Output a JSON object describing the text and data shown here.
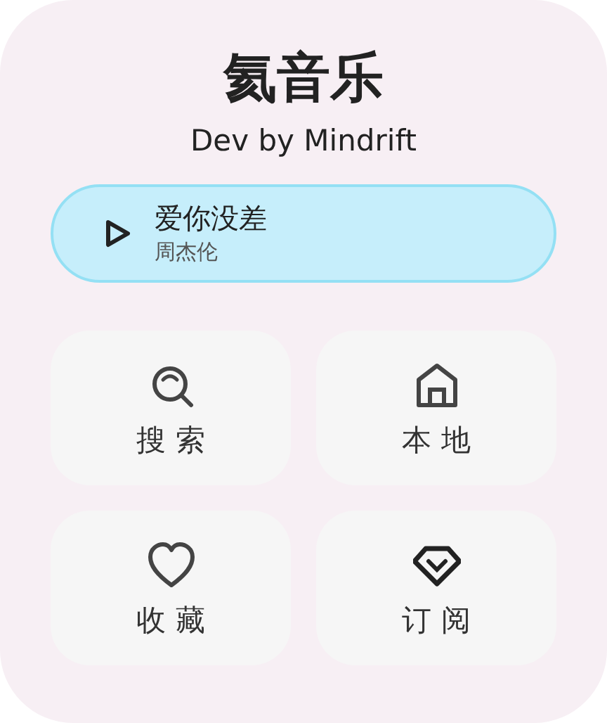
{
  "app": {
    "title": "氦音乐",
    "subtitle": "Dev by Mindrift"
  },
  "now_playing": {
    "song": "爱你没差",
    "artist": "周杰伦"
  },
  "tiles": [
    {
      "kind": "search",
      "label": "搜 索"
    },
    {
      "kind": "home",
      "label": "本 地"
    },
    {
      "kind": "heart",
      "label": "收 藏"
    },
    {
      "kind": "diamond",
      "label": "订 阅"
    }
  ]
}
